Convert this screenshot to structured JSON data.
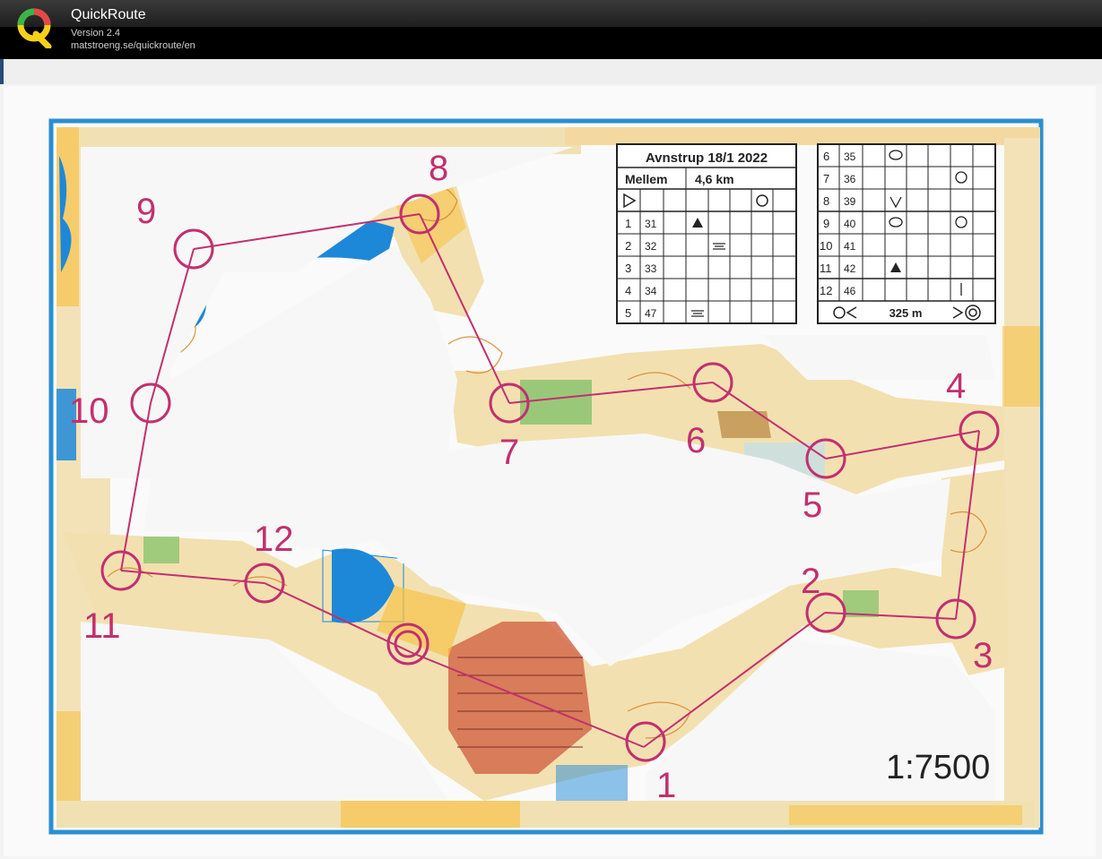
{
  "app": {
    "title": "QuickRoute",
    "version": "Version 2.4",
    "url": "matstroeng.se/quickroute/en"
  },
  "map": {
    "scale_label": "1:7500",
    "controls": [
      "1",
      "2",
      "3",
      "4",
      "5",
      "6",
      "7",
      "8",
      "9",
      "10",
      "11",
      "12"
    ]
  },
  "description_left": {
    "title": "Avnstrup 18/1 2022",
    "class": "Mellem",
    "length": "4,6 km",
    "rows": [
      {
        "n": "1",
        "code": "31"
      },
      {
        "n": "2",
        "code": "32"
      },
      {
        "n": "3",
        "code": "33"
      },
      {
        "n": "4",
        "code": "34"
      },
      {
        "n": "5",
        "code": "47"
      }
    ]
  },
  "description_right": {
    "rows": [
      {
        "n": "6",
        "code": "35"
      },
      {
        "n": "7",
        "code": "36"
      },
      {
        "n": "8",
        "code": "39"
      },
      {
        "n": "9",
        "code": "40"
      },
      {
        "n": "10",
        "code": "41"
      },
      {
        "n": "11",
        "code": "42"
      },
      {
        "n": "12",
        "code": "46"
      }
    ],
    "finish_distance": "325 m"
  },
  "colors": {
    "course": "#c2306f",
    "water": "#1e88d8",
    "frame": "#2a8fd0",
    "forest_open": "#f6c34a",
    "contour": "#d98a2f",
    "vegetation": "#7cc067"
  }
}
